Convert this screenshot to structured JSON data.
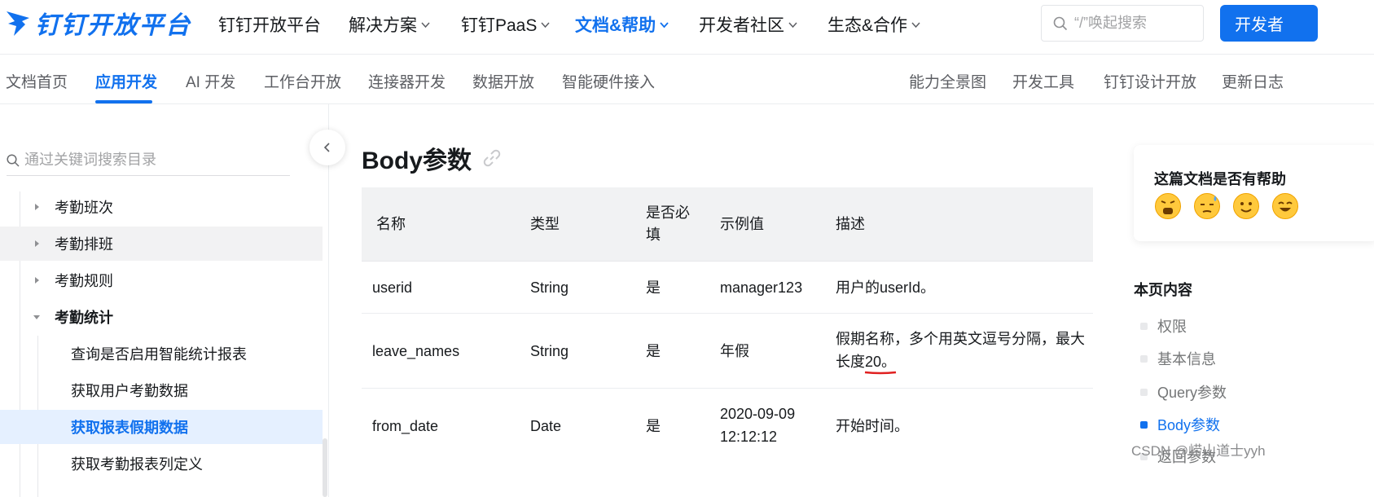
{
  "brand": {
    "logo_text": "钉钉开放平台",
    "accent": "#1171ee"
  },
  "topnav": {
    "items": [
      {
        "label": "钉钉开放平台",
        "dropdown": false
      },
      {
        "label": "解决方案",
        "dropdown": true
      },
      {
        "label": "钉钉PaaS",
        "dropdown": true
      },
      {
        "label": "文档&帮助",
        "dropdown": true,
        "active": true
      },
      {
        "label": "开发者社区",
        "dropdown": true
      },
      {
        "label": "生态&合作",
        "dropdown": true
      }
    ],
    "search_placeholder": "“/”唤起搜索",
    "dev_button": "开发者"
  },
  "subnav": {
    "items": [
      "文档首页",
      "应用开发",
      "AI 开发",
      "工作台开放",
      "连接器开发",
      "数据开放",
      "智能硬件接入"
    ],
    "active_index": 1,
    "right_items": [
      "能力全景图",
      "开发工具",
      "钉钉设计开放",
      "更新日志"
    ]
  },
  "sidebar": {
    "search_placeholder": "通过关键词搜索目录",
    "tree": [
      {
        "label": "考勤班次",
        "level": 1,
        "state": "collapsed"
      },
      {
        "label": "考勤排班",
        "level": 1,
        "state": "collapsed",
        "hover": true
      },
      {
        "label": "考勤规则",
        "level": 1,
        "state": "collapsed"
      },
      {
        "label": "考勤统计",
        "level": 1,
        "state": "expanded"
      },
      {
        "label": "查询是否启用智能统计报表",
        "level": 2
      },
      {
        "label": "获取用户考勤数据",
        "level": 2
      },
      {
        "label": "获取报表假期数据",
        "level": 2,
        "selected": true
      },
      {
        "label": "获取考勤报表列定义",
        "level": 2
      }
    ]
  },
  "main": {
    "title": "Body参数",
    "table": {
      "headers": [
        "名称",
        "类型",
        "是否必填",
        "示例值",
        "描述"
      ],
      "rows": [
        [
          "userid",
          "String",
          "是",
          "manager123",
          "用户的userId。"
        ],
        [
          "leave_names",
          "String",
          "是",
          "年假",
          "假期名称，多个用英文逗号分隔，最大长度20。"
        ],
        [
          "from_date",
          "Date",
          "是",
          "2020-09-09 12:12:12",
          "开始时间。"
        ]
      ]
    }
  },
  "right": {
    "feedback_question": "这篇文档是否有帮助",
    "emojis": [
      "angry-face-icon",
      "sweat-face-icon",
      "smile-face-icon",
      "happy-face-icon"
    ],
    "toc_title": "本页内容",
    "toc": [
      "权限",
      "基本信息",
      "Query参数",
      "Body参数",
      "返回参数"
    ],
    "toc_active_index": 3
  },
  "watermark": "CSDN @崂山道士yyh"
}
